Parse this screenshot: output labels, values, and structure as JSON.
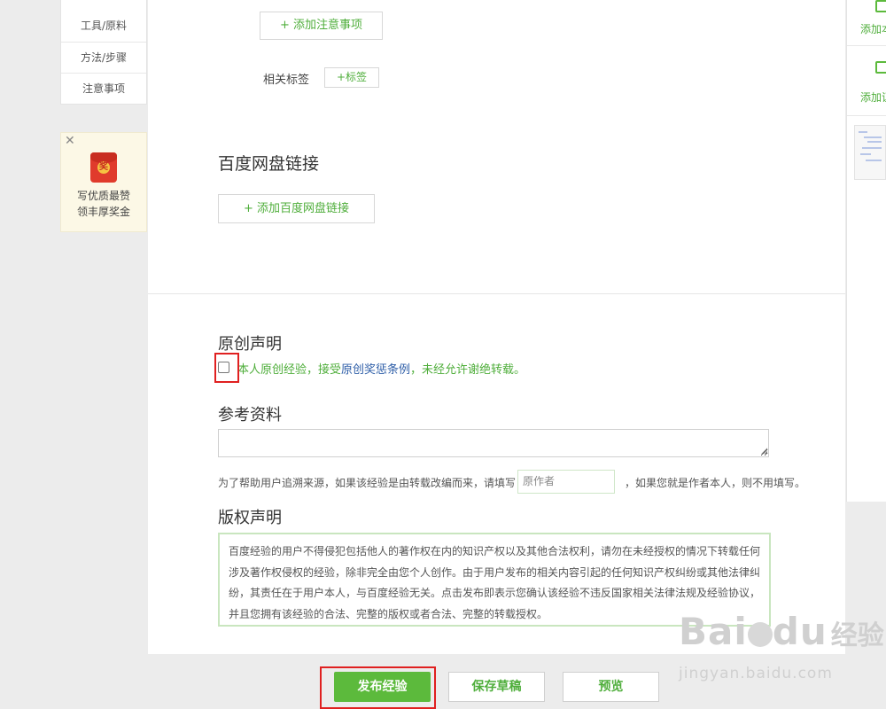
{
  "left_nav": {
    "items": [
      "工具/原料",
      "方法/步骤",
      "注意事项"
    ]
  },
  "promo": {
    "close": "✕",
    "badge": "奖",
    "line1": "写优质最赞",
    "line2": "领丰厚奖金"
  },
  "editor": {
    "add_note_button": "+ 添加注意事项",
    "tags_label": "相关标签",
    "tag_button": "+标签",
    "pan_title": "百度网盘链接",
    "pan_button": "+ 添加百度网盘链接"
  },
  "original": {
    "title": "原创声明",
    "text_before": "本人原创经验，接受",
    "link": "原创奖惩条例",
    "text_after": "，未经允许谢绝转载。",
    "checked": false
  },
  "reference": {
    "title": "参考资料",
    "hint_before": "为了帮助用户追溯来源，如果该经验是由转载改编而来，请填写",
    "author_placeholder": "原作者",
    "hint_after": "，如果您就是作者本人，则不用填写。"
  },
  "copyright": {
    "title": "版权声明",
    "text": "百度经验的用户不得侵犯包括他人的著作权在内的知识产权以及其他合法权利，请勿在未经授权的情况下转载任何涉及著作权侵权的经验，除非完全由您个人创作。由于用户发布的相关内容引起的任何知识产权纠纷或其他法律纠纷，其责任在于用户本人，与百度经验无关。点击发布即表示您确认该经验不违反国家相关法律法规及经验协议，并且您拥有该经验的合法、完整的版权或者合法、完整的转载授权。"
  },
  "actions": {
    "publish": "发布经验",
    "save_draft": "保存草稿",
    "preview": "预览"
  },
  "right_sidebar": {
    "item1": "添加本",
    "item2": "添加证"
  },
  "watermark": {
    "brand_a": "Bai",
    "brand_b": "du",
    "brand_cn": "经验",
    "url": "jingyan.baidu.com"
  },
  "colors": {
    "accent_green": "#5cba3c",
    "link_blue": "#2f5fa8",
    "highlight_red": "#e02020"
  }
}
